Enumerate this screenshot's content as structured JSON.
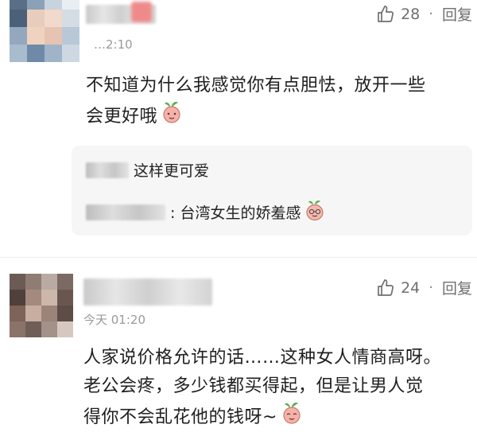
{
  "comments": [
    {
      "time": "…2:10",
      "likes": "28",
      "separator": "·",
      "reply_label": "回复",
      "text_line1": "不知道为什么我感觉你有点胆怯，放开一些",
      "text_line2": "会更好哦",
      "replies": [
        {
          "text": "这样更可爱"
        },
        {
          "text": ": 台湾女生的娇羞感"
        }
      ]
    },
    {
      "time": "今天 01:20",
      "likes": "24",
      "separator": "·",
      "reply_label": "回复",
      "text_line1": "人家说价格允许的话……这种女人情商高呀。",
      "text_line2": "老公会疼，多少钱都买得起，但是让男人觉",
      "text_line3": "得你不会乱花他的钱呀~"
    }
  ],
  "icons": {
    "like": "thumbs-up-icon",
    "sticker": "radish-emoji-icon"
  },
  "colors": {
    "text": "#1f1f1f",
    "meta": "#9a9a9a",
    "reply_bg": "#f6f6f6"
  }
}
